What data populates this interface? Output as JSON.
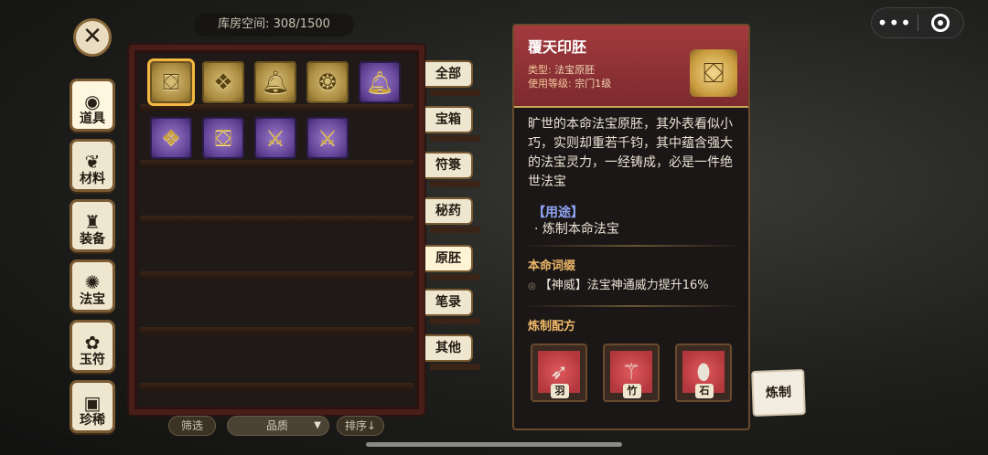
{
  "capsule": {
    "more": "•••"
  },
  "nav": {
    "close": "✕",
    "tabs": [
      {
        "label": "道具",
        "icon": "bag-icon"
      },
      {
        "label": "材料",
        "icon": "leaf-icon"
      },
      {
        "label": "装备",
        "icon": "armor-icon"
      },
      {
        "label": "法宝",
        "icon": "gourd-icon"
      },
      {
        "label": "玉符",
        "icon": "talisman-icon"
      },
      {
        "label": "珍稀",
        "icon": "chest-icon"
      }
    ]
  },
  "inventory": {
    "capacity": "库房空间: 308/1500",
    "row1": [
      {
        "icon": "treasure-box-icon",
        "rarity": "gold"
      },
      {
        "icon": "seal-cube-icon",
        "rarity": "gold"
      },
      {
        "icon": "bell-icon",
        "rarity": "gold"
      },
      {
        "icon": "cauldron-icon",
        "rarity": "gold"
      },
      {
        "icon": "bell-icon",
        "rarity": "purple"
      }
    ],
    "row2": [
      {
        "icon": "seal-cube-icon",
        "rarity": "purple"
      },
      {
        "icon": "treasure-box-icon",
        "rarity": "purple"
      },
      {
        "icon": "sword-icon",
        "rarity": "purple"
      },
      {
        "icon": "sword-icon",
        "rarity": "purple"
      }
    ],
    "categories": [
      "全部",
      "宝箱",
      "符箓",
      "秘药",
      "原胚",
      "笔录",
      "其他"
    ],
    "filter": "筛选",
    "quality": "品质",
    "sort": "排序↓"
  },
  "detail": {
    "name": "覆天印胚",
    "type_label": "类型:",
    "type_value": "法宝原胚",
    "level_label": "使用等级:",
    "level_value": "宗门1级",
    "description": "旷世的本命法宝原胚，其外表看似小巧，实则却重若千钧，其中蕴含强大的法宝灵力，一经铸成，必是一件绝世法宝",
    "usage_title": "【用途】",
    "usage_item": "· 炼制本命法宝",
    "affix_title": "本命词缀",
    "affix": "【神威】法宝神通威力提升16%",
    "recipe_title": "炼制配方",
    "materials": [
      {
        "label": "羽",
        "icon": "feather-icon"
      },
      {
        "label": "竹",
        "icon": "bamboo-icon"
      },
      {
        "label": "石",
        "icon": "stone-icon"
      }
    ],
    "craft": "炼制"
  },
  "colors": {
    "header_red": "#a33a3e",
    "accent_gold": "#f0b86a",
    "usage_blue": "#8fa3f4"
  }
}
